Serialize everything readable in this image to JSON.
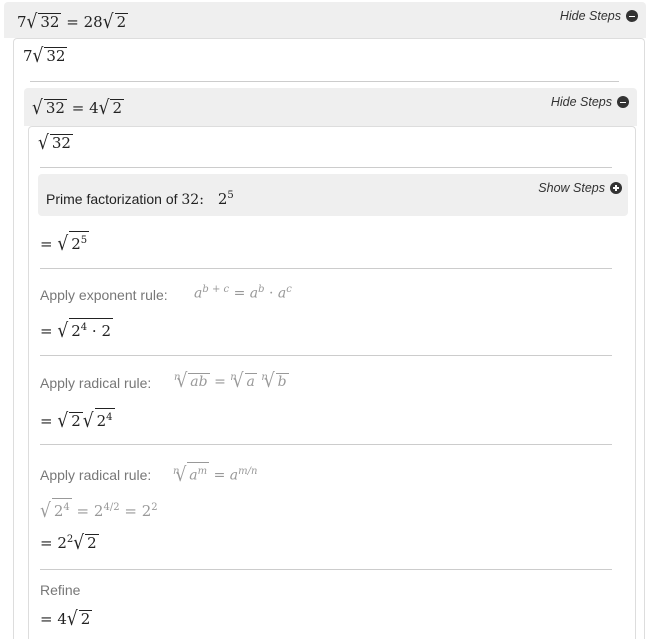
{
  "level1": {
    "header_lhs_coef": "7",
    "header_lhs_rad": "32",
    "header_eq": "=",
    "header_rhs_coef": "28",
    "header_rhs_rad": "2",
    "toggle_label": "Hide Steps",
    "start_coef": "7",
    "start_rad": "32"
  },
  "level2": {
    "header_lhs_rad": "32",
    "header_eq": "=",
    "header_rhs_coef": "4",
    "header_rhs_rad": "2",
    "toggle_label": "Hide Steps",
    "start_rad": "32"
  },
  "prime": {
    "label": "Prime factorization of",
    "number": "32:",
    "result_base": "2",
    "result_exp": "5",
    "toggle_label": "Show Steps"
  },
  "step1": {
    "eq": "=",
    "base": "2",
    "exp": "5"
  },
  "step2": {
    "label": "Apply exponent rule:",
    "rule_base": "a",
    "rule_exp": "b + c",
    "rule_eq": "=",
    "rule_a1": "a",
    "rule_e1": "b",
    "rule_dot": "·",
    "rule_a2": "a",
    "rule_e2": "c",
    "eq": "=",
    "base": "2",
    "exp": "4",
    "dot": "·",
    "factor": "2"
  },
  "step3": {
    "label": "Apply radical rule:",
    "rule_idx1": "n",
    "rule_rad1": "ab",
    "rule_eq": "=",
    "rule_idx2": "n",
    "rule_rad2": "a",
    "rule_idx3": "n",
    "rule_rad3": "b",
    "eq": "=",
    "rad1": "2",
    "rad2_base": "2",
    "rad2_exp": "4"
  },
  "step4": {
    "label": "Apply radical rule:",
    "rule_idx": "n",
    "rule_base": "a",
    "rule_exp": "m",
    "rule_eq": "=",
    "rule_rhs_base": "a",
    "rule_rhs_num": "m",
    "rule_rhs_den": "n",
    "sub_base": "2",
    "sub_exp": "4",
    "sub_eq1": "=",
    "sub_mid_base": "2",
    "sub_mid_num": "4",
    "sub_mid_den": "2",
    "sub_eq2": "=",
    "sub_res_base": "2",
    "sub_res_exp": "2",
    "eq": "=",
    "coef_base": "2",
    "coef_exp": "2",
    "rad": "2"
  },
  "step5": {
    "label": "Refine",
    "eq": "=",
    "coef": "4",
    "rad": "2"
  }
}
